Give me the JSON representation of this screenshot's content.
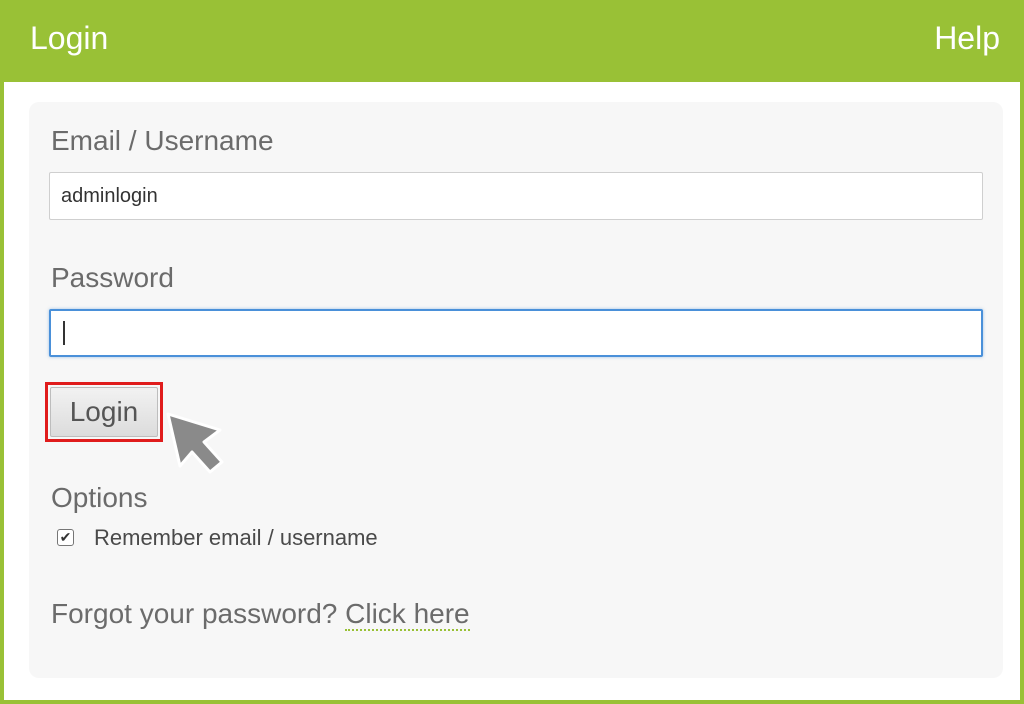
{
  "header": {
    "title": "Login",
    "help_label": "Help"
  },
  "form": {
    "username_label": "Email / Username",
    "username_value": "adminlogin",
    "password_label": "Password",
    "password_value": "",
    "login_button": "Login",
    "options_label": "Options",
    "remember_label": "Remember email / username",
    "remember_checked": true,
    "forgot_text": "Forgot your password?",
    "forgot_link": "Click here"
  },
  "colors": {
    "brand": "#99c136",
    "highlight": "#e01c1c",
    "focus": "#4a90d9"
  },
  "icons": {
    "cursor": "cursor-arrow-icon",
    "checkmark": "checkmark-icon"
  }
}
